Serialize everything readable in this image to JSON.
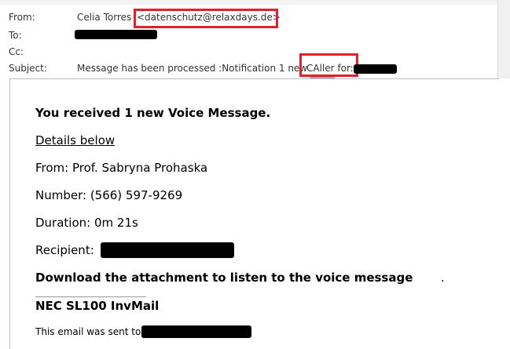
{
  "header": {
    "from_label": "From:",
    "from_name": "Celia Torres",
    "from_email": "<datenschutz@relaxdays.de>",
    "to_label": "To:",
    "cc_label": "Cc:",
    "subject_label": "Subject:",
    "subject_text": "Message has been processed :Notification 1 new",
    "subject_caller": "CAller for:"
  },
  "body": {
    "headline": "You received 1 new Voice Message.",
    "details_link": "Details below",
    "from_line": "From: Prof. Sabryna Prohaska",
    "number_line": "Number: (566) 597-9269",
    "duration_line": "Duration: 0m 21s",
    "recipient_label": "Recipient:",
    "download_line": "Download the attachment to listen to the voice message",
    "download_period": ".",
    "signature": "NEC SL100 InvMail",
    "footer_text": "This email was sent to"
  },
  "colors": {
    "highlight_box": "#e0202a",
    "redaction": "#000000"
  }
}
